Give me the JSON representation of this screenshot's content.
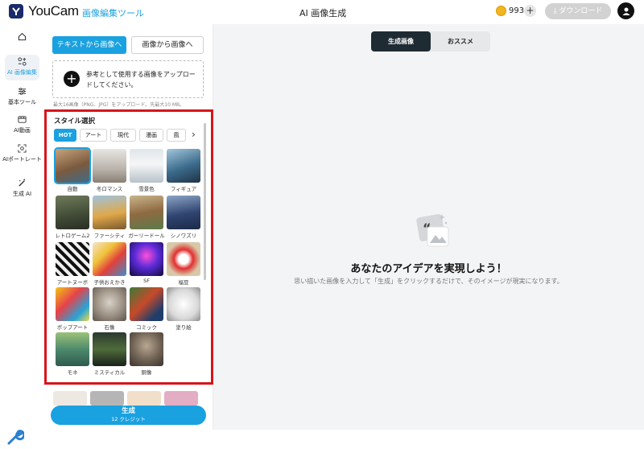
{
  "header": {
    "brand": "YouCam",
    "brand_sub": "画像編集ツール",
    "page_title": "AI 画像生成",
    "credits": "9930",
    "plus": "+",
    "download_label": "ダウンロード"
  },
  "nav": {
    "items": [
      {
        "label": "",
        "icon": "home-icon"
      },
      {
        "label": "AI 画像編集",
        "icon": "ai-edit-icon"
      },
      {
        "label": "基本ツール",
        "icon": "sliders-icon"
      },
      {
        "label": "AI動画",
        "icon": "video-icon"
      },
      {
        "label": "AIポートレート",
        "icon": "portrait-icon"
      },
      {
        "label": "生成 AI",
        "icon": "wand-icon"
      }
    ]
  },
  "panel": {
    "tab_text_to_image": "テキストから画像へ",
    "tab_image_to_image": "画像から画像へ",
    "upload_text": "参考として使用する画像をアップロードしてください。",
    "upload_note": "最大16画像（PNG、JPG）をアップロード。先最大10 MB。",
    "style_title": "スタイル選択",
    "chips": [
      "HOT",
      "アート",
      "現代",
      "漫画",
      "風"
    ],
    "styles": [
      {
        "label": "自動"
      },
      {
        "label": "冬ロマンス"
      },
      {
        "label": "雪景色"
      },
      {
        "label": "フィギュア"
      },
      {
        "label": "レトロゲーム2"
      },
      {
        "label": "ファーシティ"
      },
      {
        "label": "ガーリードール"
      },
      {
        "label": "シノワズリ"
      },
      {
        "label": "アートヌーボ"
      },
      {
        "label": "子供おえかき"
      },
      {
        "label": "SF"
      },
      {
        "label": "福豆"
      },
      {
        "label": "ポップアート"
      },
      {
        "label": "石像"
      },
      {
        "label": "コミック"
      },
      {
        "label": "塗り絵"
      },
      {
        "label": "モネ"
      },
      {
        "label": "ミスティカル"
      },
      {
        "label": "銅像"
      }
    ],
    "generate_label": "生成",
    "generate_credits": "12 クレジット"
  },
  "right": {
    "seg_generated": "生成画像",
    "seg_recommend": "おススメ",
    "headline": "あなたのアイデアを実現しよう！",
    "subline": "思い描いた画像を入力して「生成」をクリックするだけで、そのイメージが現実になります。"
  }
}
